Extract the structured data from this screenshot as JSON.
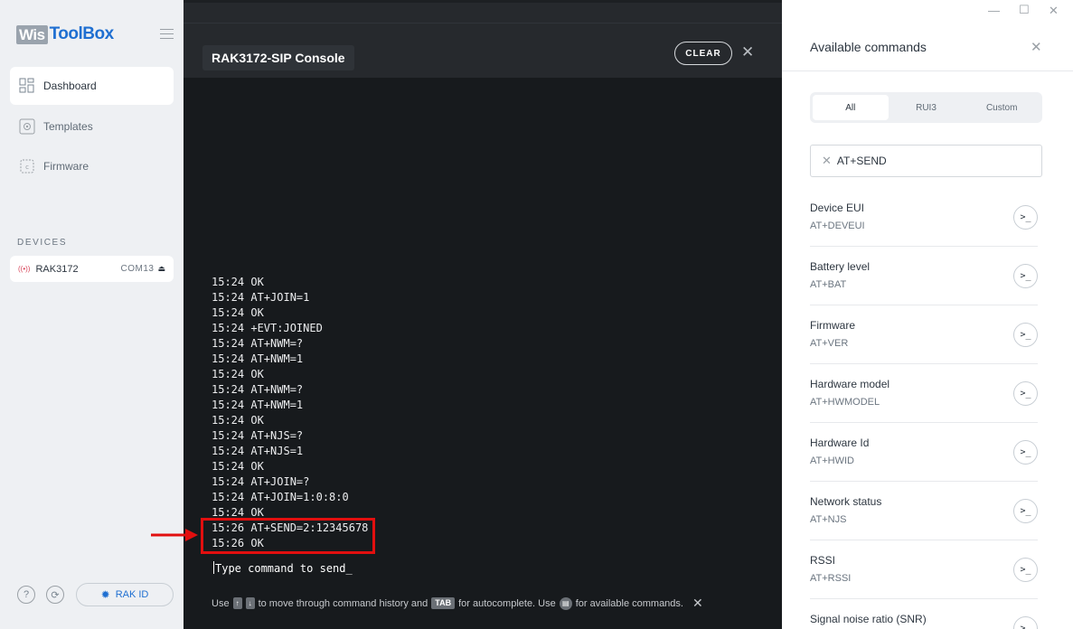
{
  "sidebar": {
    "logo_wis": "Wis",
    "logo_toolbox": "ToolBox",
    "nav": [
      {
        "label": "Dashboard"
      },
      {
        "label": "Templates"
      },
      {
        "label": "Firmware"
      }
    ],
    "devices_heading": "DEVICES",
    "device": {
      "name": "RAK3172",
      "port": "COM13"
    },
    "rakid_label": "RAK ID"
  },
  "console": {
    "title": "RAK3172-SIP Console",
    "clear_label": "CLEAR",
    "log": [
      "15:24 OK",
      "15:24 AT+JOIN=1",
      "15:24 OK",
      "15:24 +EVT:JOINED",
      "15:24 AT+NWM=?",
      "15:24 AT+NWM=1",
      "15:24 OK",
      "15:24 AT+NWM=?",
      "15:24 AT+NWM=1",
      "15:24 OK",
      "15:24 AT+NJS=?",
      "15:24 AT+NJS=1",
      "15:24 OK",
      "15:24 AT+JOIN=?",
      "15:24 AT+JOIN=1:0:8:0",
      "15:24 OK",
      "15:26 AT+SEND=2:12345678",
      "15:26 OK"
    ],
    "prompt_placeholder": "Type command to send_",
    "hint": {
      "part1": "Use",
      "up_key": "↑",
      "down_key": "↓",
      "part2": "to move through command history and",
      "tab_key": "TAB",
      "part3": "for autocomplete. Use",
      "part4": "for available commands."
    }
  },
  "panel": {
    "title": "Available commands",
    "tabs": [
      {
        "label": "All"
      },
      {
        "label": "RUI3"
      },
      {
        "label": "Custom"
      }
    ],
    "search_value": "AT+SEND",
    "commands": [
      {
        "name": "Device EUI",
        "code": "AT+DEVEUI"
      },
      {
        "name": "Battery level",
        "code": "AT+BAT"
      },
      {
        "name": "Firmware",
        "code": "AT+VER"
      },
      {
        "name": "Hardware model",
        "code": "AT+HWMODEL"
      },
      {
        "name": "Hardware Id",
        "code": "AT+HWID"
      },
      {
        "name": "Network status",
        "code": "AT+NJS"
      },
      {
        "name": "RSSI",
        "code": "AT+RSSI"
      },
      {
        "name": "Signal noise ratio (SNR)",
        "code": ""
      }
    ]
  },
  "colors": {
    "accent_blue": "#1f6fd1",
    "highlight_red": "#e20f0f",
    "console_bg": "#171a1d"
  }
}
